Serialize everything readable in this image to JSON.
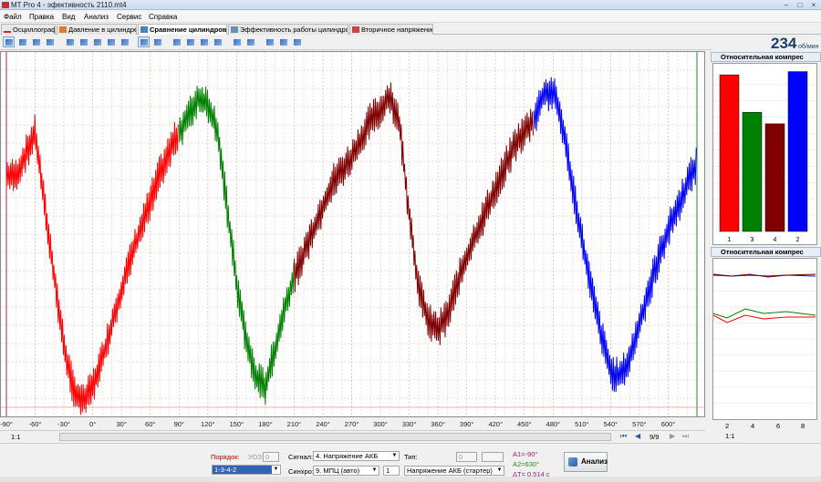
{
  "window": {
    "title": "MT Pro 4 - эфективность 2110.mt4"
  },
  "menu": [
    "Файл",
    "Правка",
    "Вид",
    "Анализ",
    "Сервис",
    "Справка"
  ],
  "tabs": [
    {
      "label": "Осциллограф",
      "icon": "waveform-icon"
    },
    {
      "label": "Давление в цилиндре",
      "icon": "cylinder-pressure-icon"
    },
    {
      "label": "Сравнение цилиндров",
      "icon": "compare-cylinders-icon",
      "active": true
    },
    {
      "label": "Эффективность работы цилиндров",
      "icon": "efficiency-icon"
    },
    {
      "label": "Вторичное напряжение",
      "icon": "secondary-voltage-icon"
    }
  ],
  "rpm": {
    "value": "234",
    "unit": "об/мин"
  },
  "x_axis_labels": [
    "-90°",
    "-60°",
    "-30°",
    "0°",
    "30°",
    "60°",
    "90°",
    "120°",
    "150°",
    "180°",
    "210°",
    "240°",
    "270°",
    "300°",
    "330°",
    "360°",
    "390°",
    "420°",
    "450°",
    "480°",
    "510°",
    "540°",
    "570°",
    "600°"
  ],
  "zoom_label": "1:1",
  "page_label": "9/9",
  "colors": {
    "cyl1": "#ff0000",
    "cyl3": "#008000",
    "cyl4": "#800000",
    "cyl2": "#0000ff",
    "grid": "#e3b8b8"
  },
  "panel_bar": {
    "title": "Относительная компрес",
    "bars": [
      {
        "label": "1",
        "value": 0.96,
        "color": "#ff0000"
      },
      {
        "label": "3",
        "value": 0.73,
        "color": "#008000"
      },
      {
        "label": "4",
        "value": 0.66,
        "color": "#800000"
      },
      {
        "label": "2",
        "value": 0.98,
        "color": "#0000ff"
      }
    ]
  },
  "panel_line": {
    "title": "Относительная компрес",
    "x_labels": [
      "2",
      "4",
      "6",
      "8"
    ],
    "zoom_label": "1:1"
  },
  "controls": {
    "order_label": "Порядок:",
    "order_value": "1-3-4-2",
    "uoz_label": "УОЗ:",
    "uoz_value": "0",
    "signal_label": "Сигнал:",
    "signal_value": "4. Напряжение АКБ",
    "sync_label": "Синхро:",
    "sync_value": "9. МПЦ (авто)",
    "sync_num": "1",
    "type_label": "Тип:",
    "type_num": "0",
    "type_value": "Напряжение АКБ (стартер)",
    "a1": "A1=-90°",
    "a2": "A2=630°",
    "dt": "ΔT= 0,514 с",
    "analyze_label": "Анализ"
  },
  "chart_data": {
    "type": "line",
    "xlabel": "",
    "ylabel": "",
    "xlim": [
      -90,
      630
    ],
    "series": [
      {
        "name": "1",
        "color": "#ff0000",
        "x": [
          -90,
          -80,
          -60,
          -50,
          -40,
          -30,
          -20,
          -10,
          0,
          10,
          20,
          30,
          40,
          50,
          60,
          70,
          80,
          90
        ],
        "y": [
          0.72,
          0.72,
          0.86,
          0.62,
          0.4,
          0.18,
          0.04,
          0.0,
          0.05,
          0.14,
          0.25,
          0.36,
          0.46,
          0.55,
          0.64,
          0.73,
          0.8,
          0.86
        ]
      },
      {
        "name": "3",
        "color": "#008000",
        "x": [
          90,
          100,
          110,
          120,
          130,
          140,
          150,
          160,
          170,
          180,
          190,
          200,
          210
        ],
        "y": [
          0.86,
          0.91,
          0.97,
          0.95,
          0.87,
          0.62,
          0.38,
          0.2,
          0.08,
          0.05,
          0.17,
          0.3,
          0.4
        ]
      },
      {
        "name": "4",
        "color": "#800000",
        "x": [
          210,
          230,
          250,
          270,
          290,
          300,
          310,
          320,
          330,
          340,
          350,
          360,
          370,
          380,
          400,
          420,
          440,
          460
        ],
        "y": [
          0.4,
          0.55,
          0.7,
          0.78,
          0.9,
          0.93,
          0.98,
          0.88,
          0.6,
          0.36,
          0.26,
          0.23,
          0.28,
          0.38,
          0.54,
          0.68,
          0.82,
          0.9
        ]
      },
      {
        "name": "2",
        "color": "#0000ff",
        "x": [
          460,
          470,
          480,
          490,
          500,
          510,
          520,
          530,
          540,
          550,
          560,
          570,
          580,
          590,
          600,
          610,
          620,
          630
        ],
        "y": [
          0.9,
          0.98,
          0.99,
          0.88,
          0.7,
          0.52,
          0.36,
          0.22,
          0.1,
          0.08,
          0.14,
          0.25,
          0.36,
          0.46,
          0.55,
          0.62,
          0.7,
          0.76
        ]
      }
    ]
  }
}
